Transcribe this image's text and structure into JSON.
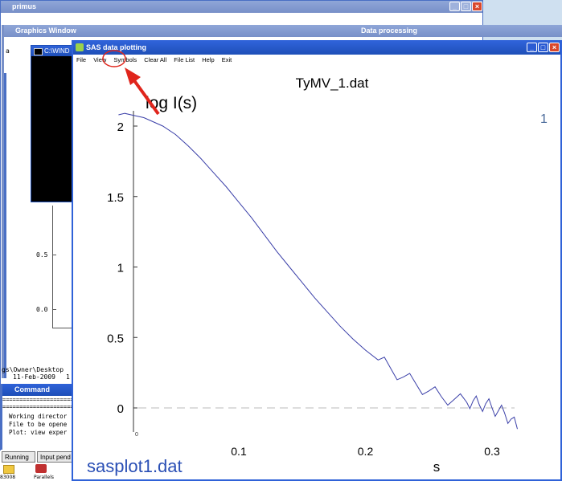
{
  "windows": {
    "primus": {
      "title": "primus"
    },
    "graphics": {
      "title": "Graphics Window"
    },
    "data_processing": {
      "title": "Data processing"
    },
    "console": {
      "title": "C:\\WIND"
    },
    "command": {
      "title": "Command Window",
      "separator": "==================================",
      "lines": [
        "Working director",
        "File to be opene",
        "Plot: view exper"
      ]
    },
    "sas": {
      "title": "SAS data plotting"
    }
  },
  "sas_menu": [
    "File",
    "View",
    "Symbols",
    "Clear All",
    "File List",
    "Help",
    "Exit"
  ],
  "background": {
    "left_label": "a",
    "axis_ticks": [
      "0.5",
      "0.0"
    ],
    "path_text": "gs\\Owner\\Desktop",
    "date_text": "11-Feb-2009",
    "date_suffix": "1"
  },
  "taskbar": {
    "buttons": [
      "Running",
      "Input pend"
    ],
    "items": [
      "83008",
      "Parallels"
    ]
  },
  "overlay": {
    "file_label": "sasplot1.dat"
  },
  "chart_data": {
    "type": "line",
    "title": "TyMV_1.dat",
    "ylabel": "log I(s)",
    "xlabel": "s",
    "curve_number": "1",
    "xlim": [
      0.0,
      0.32
    ],
    "ylim": [
      -0.15,
      2.1
    ],
    "xticks": [
      "0.1",
      "0.2",
      "0.3"
    ],
    "yticks": [
      "0",
      "0.5",
      "1",
      "1.5",
      "2"
    ],
    "origin_label": "0",
    "series": [
      {
        "x": [
          0.005,
          0.01,
          0.015,
          0.02,
          0.025,
          0.03,
          0.04,
          0.05,
          0.06,
          0.07,
          0.08,
          0.09,
          0.1,
          0.11,
          0.12,
          0.13,
          0.14,
          0.15,
          0.16,
          0.17,
          0.18,
          0.19,
          0.2,
          0.21,
          0.22,
          0.23,
          0.24,
          0.25,
          0.26,
          0.27,
          0.28,
          0.285,
          0.29,
          0.295,
          0.3,
          0.305,
          0.31,
          0.315,
          0.32
        ],
        "y": [
          2.08,
          2.09,
          2.08,
          2.07,
          2.06,
          2.04,
          2.0,
          1.94,
          1.86,
          1.77,
          1.67,
          1.57,
          1.46,
          1.35,
          1.23,
          1.11,
          1.0,
          0.89,
          0.78,
          0.68,
          0.58,
          0.49,
          0.41,
          0.34,
          0.28,
          0.22,
          0.17,
          0.12,
          0.08,
          0.06,
          0.04,
          0.05,
          0.02,
          0.03,
          0.0,
          -0.02,
          -0.04,
          -0.08,
          -0.15
        ]
      }
    ],
    "zero_line": 0,
    "line_color": "#3a3fa8"
  },
  "colors": {
    "accent_red": "#e0251c",
    "title_blue": "#1e4fb8"
  }
}
